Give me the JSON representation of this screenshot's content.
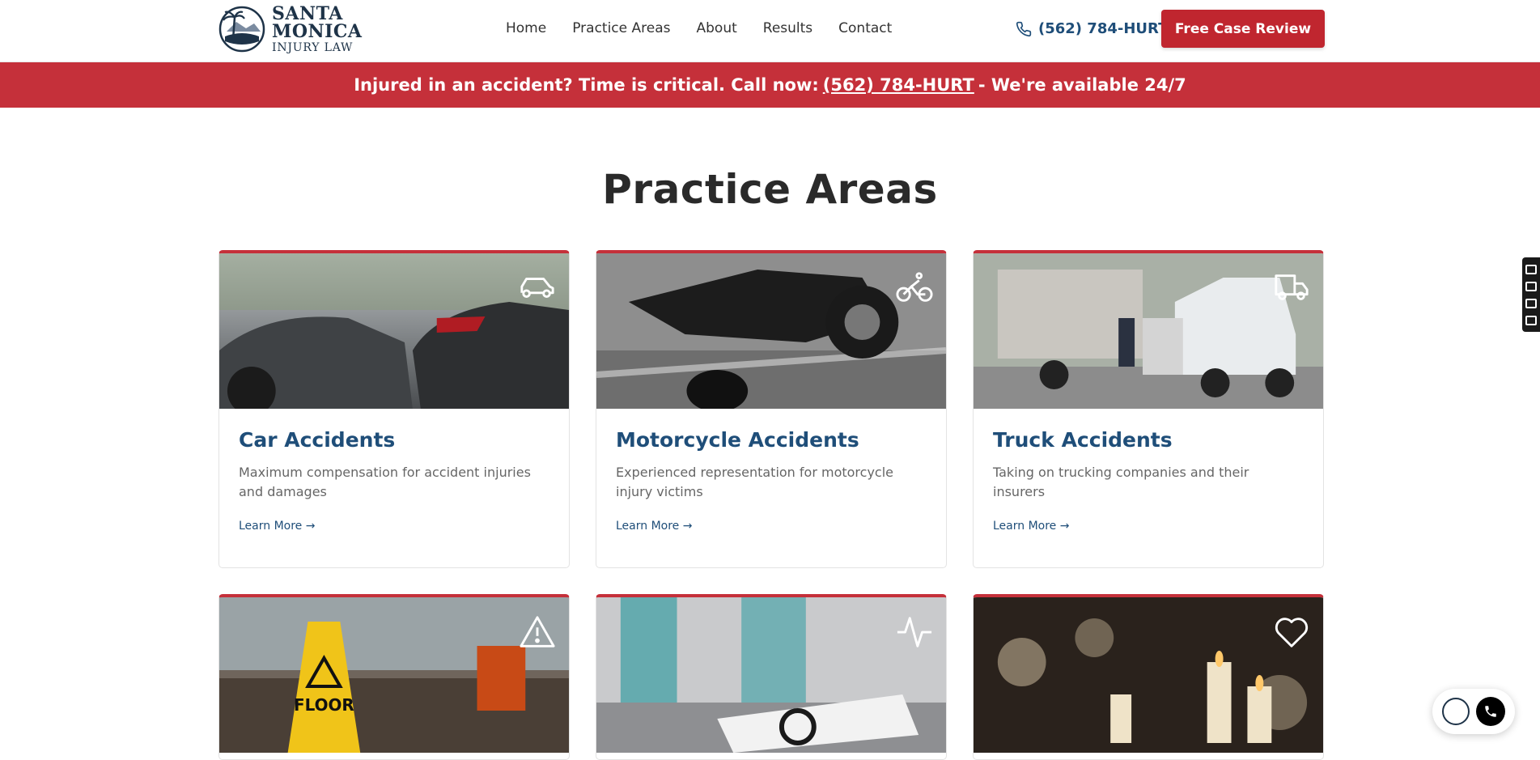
{
  "brand": {
    "line1": "SANTA",
    "line2": "MONICA",
    "line3": "INJURY LAW"
  },
  "nav": [
    {
      "label": "Home"
    },
    {
      "label": "Practice Areas"
    },
    {
      "label": "About"
    },
    {
      "label": "Results"
    },
    {
      "label": "Contact"
    }
  ],
  "header": {
    "phone": "(562) 784-HURT",
    "cta": "Free Case Review"
  },
  "banner": {
    "lead": "Injured in an accident? Time is critical. Call now:",
    "phone": "(562) 784-HURT",
    "tail": "- We're available 24/7"
  },
  "section": {
    "title": "Practice Areas"
  },
  "cards": [
    {
      "title": "Car Accidents",
      "desc": "Maximum compensation for accident injuries and damages",
      "link": "Learn More →",
      "icon": "car-icon"
    },
    {
      "title": "Motorcycle Accidents",
      "desc": "Experienced representation for motorcycle injury victims",
      "link": "Learn More →",
      "icon": "bike-icon"
    },
    {
      "title": "Truck Accidents",
      "desc": "Taking on trucking companies and their insurers",
      "link": "Learn More →",
      "icon": "truck-icon"
    },
    {
      "title": "",
      "desc": "",
      "link": "",
      "icon": "warning-icon"
    },
    {
      "title": "",
      "desc": "",
      "link": "",
      "icon": "activity-icon"
    },
    {
      "title": "",
      "desc": "",
      "link": "",
      "icon": "heart-icon"
    }
  ],
  "image_text": {
    "wet_floor_sign": "FLOOR"
  },
  "colors": {
    "accent": "#c5303a",
    "navy": "#1f4e79",
    "brand_dark": "#1e3348"
  }
}
